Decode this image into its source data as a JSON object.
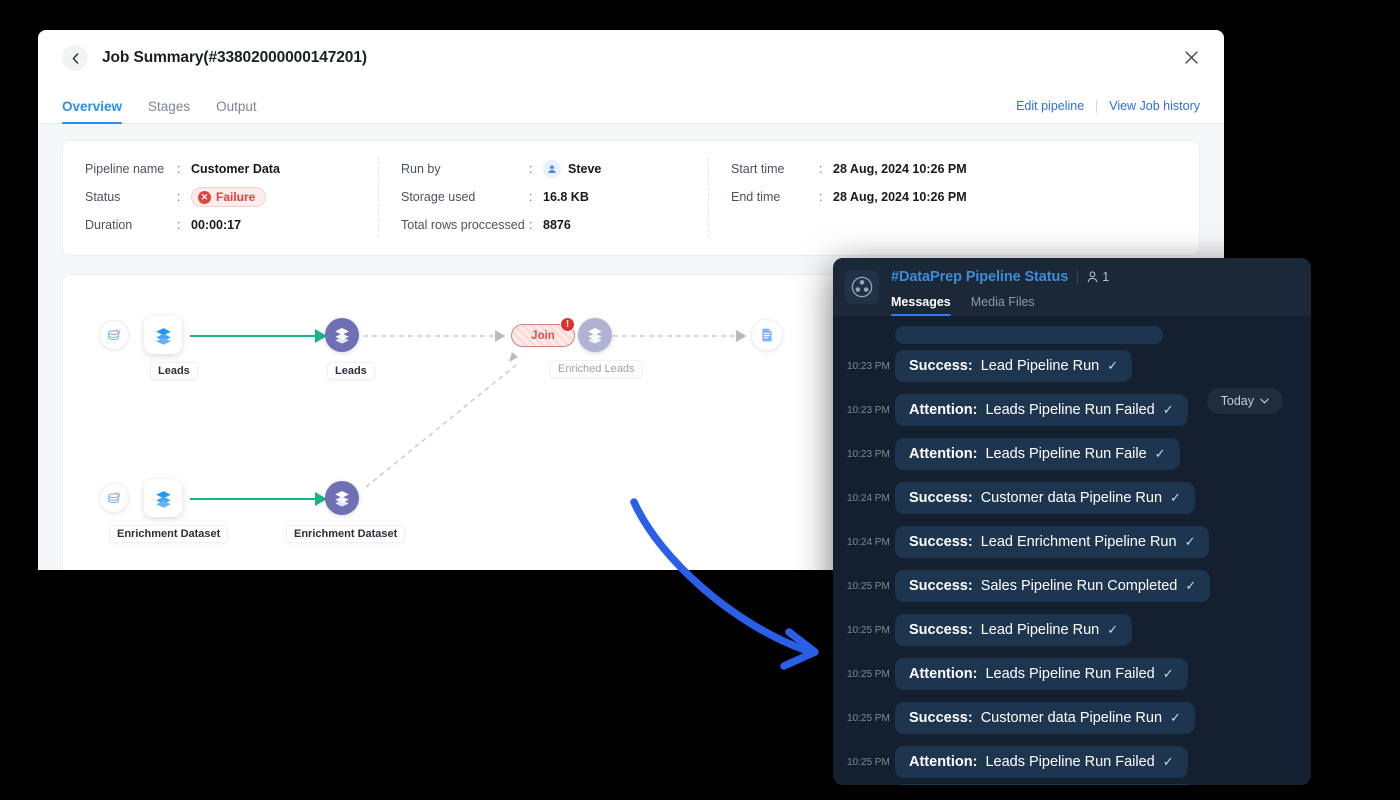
{
  "window": {
    "title": "Job Summary(#33802000000147201)",
    "back_icon": "chevron-left-icon",
    "close_icon": "close-icon"
  },
  "tabs": [
    {
      "label": "Overview",
      "active": true
    },
    {
      "label": "Stages",
      "active": false
    },
    {
      "label": "Output",
      "active": false
    }
  ],
  "header_links": [
    {
      "label": "Edit pipeline"
    },
    {
      "label": "View Job history"
    }
  ],
  "summary": {
    "col1": [
      {
        "label": "Pipeline name",
        "value": "Customer Data",
        "type": "text"
      },
      {
        "label": "Status",
        "value": "Failure",
        "type": "badge-failure"
      },
      {
        "label": "Duration",
        "value": "00:00:17",
        "type": "text"
      }
    ],
    "col2": [
      {
        "label": "Run by",
        "value": "Steve",
        "type": "avatar"
      },
      {
        "label": "Storage used",
        "value": "16.8 KB",
        "type": "text"
      },
      {
        "label": "Total rows proccessed",
        "value": "8876",
        "type": "text"
      }
    ],
    "col3": [
      {
        "label": "Start time",
        "value": "28 Aug, 2024 10:26 PM",
        "type": "text"
      },
      {
        "label": "End time",
        "value": "28 Aug, 2024 10:26 PM",
        "type": "text"
      }
    ],
    "colon": ":"
  },
  "pipeline": {
    "nodes": [
      {
        "id": "src1",
        "label": "",
        "icon": "database-icon"
      },
      {
        "id": "leads-source",
        "label": "Leads",
        "icon": "layers-blue-icon"
      },
      {
        "id": "leads-stage",
        "label": "Leads",
        "icon": "layers-white-icon"
      },
      {
        "id": "join",
        "label": "Join",
        "icon": "error-badge-icon",
        "badge": "!"
      },
      {
        "id": "enriched-leads",
        "label": "Enriched Leads",
        "icon": "layers-white-icon"
      },
      {
        "id": "output-doc",
        "label": "",
        "icon": "document-icon"
      },
      {
        "id": "src2",
        "label": "",
        "icon": "database-icon"
      },
      {
        "id": "enrichment-source",
        "label": "Enrichment Dataset",
        "icon": "layers-blue-icon"
      },
      {
        "id": "enrichment-stage",
        "label": "Enrichment Dataset",
        "icon": "layers-white-icon"
      }
    ],
    "colors": {
      "edge_active": "#18b388",
      "edge_muted": "#c9ccd2",
      "node_purple": "#6f6fb5",
      "error": "#d9342b"
    }
  },
  "chat": {
    "app_icon": "cliq-logo-icon",
    "channel_title": "#DataPrep Pipeline Status",
    "member_icon": "person-icon",
    "member_count": "1",
    "tabs": [
      {
        "label": "Messages",
        "active": true
      },
      {
        "label": "Media Files",
        "active": false
      }
    ],
    "date_filter": {
      "label": "Today",
      "icon": "chevron-down-icon"
    },
    "messages": [
      {
        "time": "10:23 PM",
        "prefix": "Success:",
        "text": "Lead Pipeline Run",
        "check": "✓"
      },
      {
        "time": "10:23 PM",
        "prefix": "Attention:",
        "text": "Leads Pipeline Run Failed",
        "check": "✓"
      },
      {
        "time": "10:23 PM",
        "prefix": "Attention:",
        "text": "Leads Pipeline Run Faile",
        "check": "✓"
      },
      {
        "time": "10:24 PM",
        "prefix": "Success:",
        "text": "Customer data Pipeline Run",
        "check": "✓"
      },
      {
        "time": "10:24 PM",
        "prefix": "Success:",
        "text": "Lead Enrichment Pipeline Run",
        "check": "✓"
      },
      {
        "time": "10:25 PM",
        "prefix": "Success:",
        "text": "Sales Pipeline Run Completed",
        "check": "✓"
      },
      {
        "time": "10:25 PM",
        "prefix": "Success:",
        "text": "Lead Pipeline Run",
        "check": "✓"
      },
      {
        "time": "10:25 PM",
        "prefix": "Attention:",
        "text": "Leads Pipeline Run Failed",
        "check": "✓"
      },
      {
        "time": "10:25 PM",
        "prefix": "Success:",
        "text": "Customer data Pipeline Run",
        "check": "✓"
      },
      {
        "time": "10:25 PM",
        "prefix": "Attention:",
        "text": "Leads Pipeline Run Failed",
        "check": "✓"
      }
    ]
  },
  "annotation": {
    "arrow_color": "#2b5fe8"
  }
}
